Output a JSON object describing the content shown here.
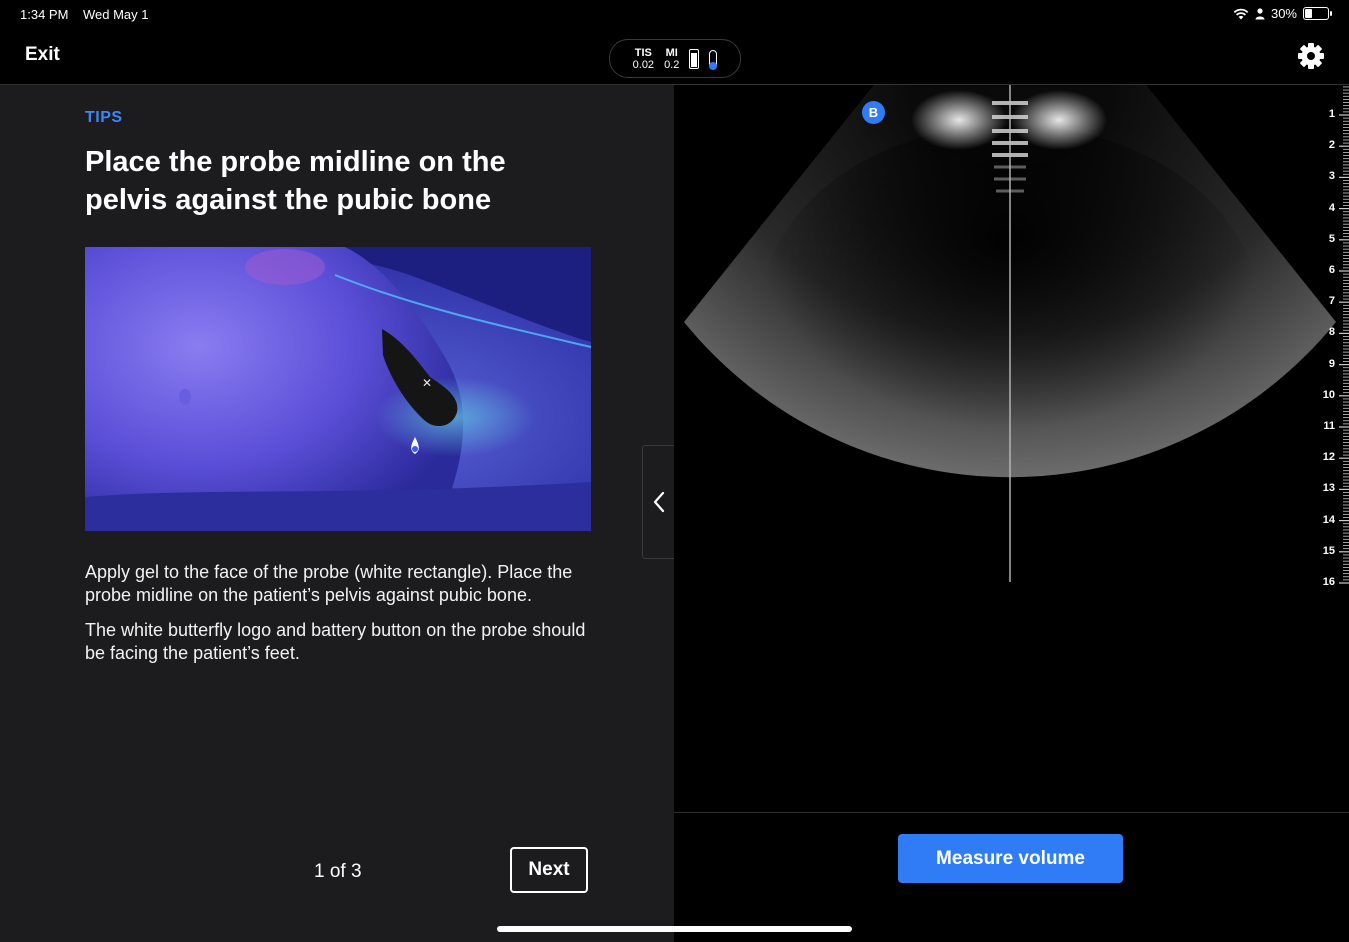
{
  "status_bar": {
    "time": "1:34 PM",
    "date": "Wed May 1",
    "battery_percent": "30%",
    "battery_level": 0.3
  },
  "header": {
    "exit_label": "Exit",
    "tis_label": "TIS",
    "tis_value": "0.02",
    "mi_label": "MI",
    "mi_value": "0.2",
    "settings_icon": "gear-icon"
  },
  "tips": {
    "section_label": "TIPS",
    "title": "Place the probe midline on the pelvis against the pubic bone",
    "paragraph_1": "Apply gel to the face of the probe (white rectangle). Place the probe midline on the patient’s pelvis against pubic bone.",
    "paragraph_2": "The white butterfly logo and battery button on the probe should be facing the patient’s feet.",
    "pager": "1 of 3",
    "next_label": "Next",
    "collapse_icon": "chevron-left-icon"
  },
  "scan": {
    "mode_badge": "B",
    "depth_ticks": [
      "1",
      "2",
      "3",
      "4",
      "5",
      "6",
      "7",
      "8",
      "9",
      "10",
      "11",
      "12",
      "13",
      "14",
      "15",
      "16"
    ],
    "measure_label": "Measure volume",
    "accent_color": "#2f7cf6"
  }
}
